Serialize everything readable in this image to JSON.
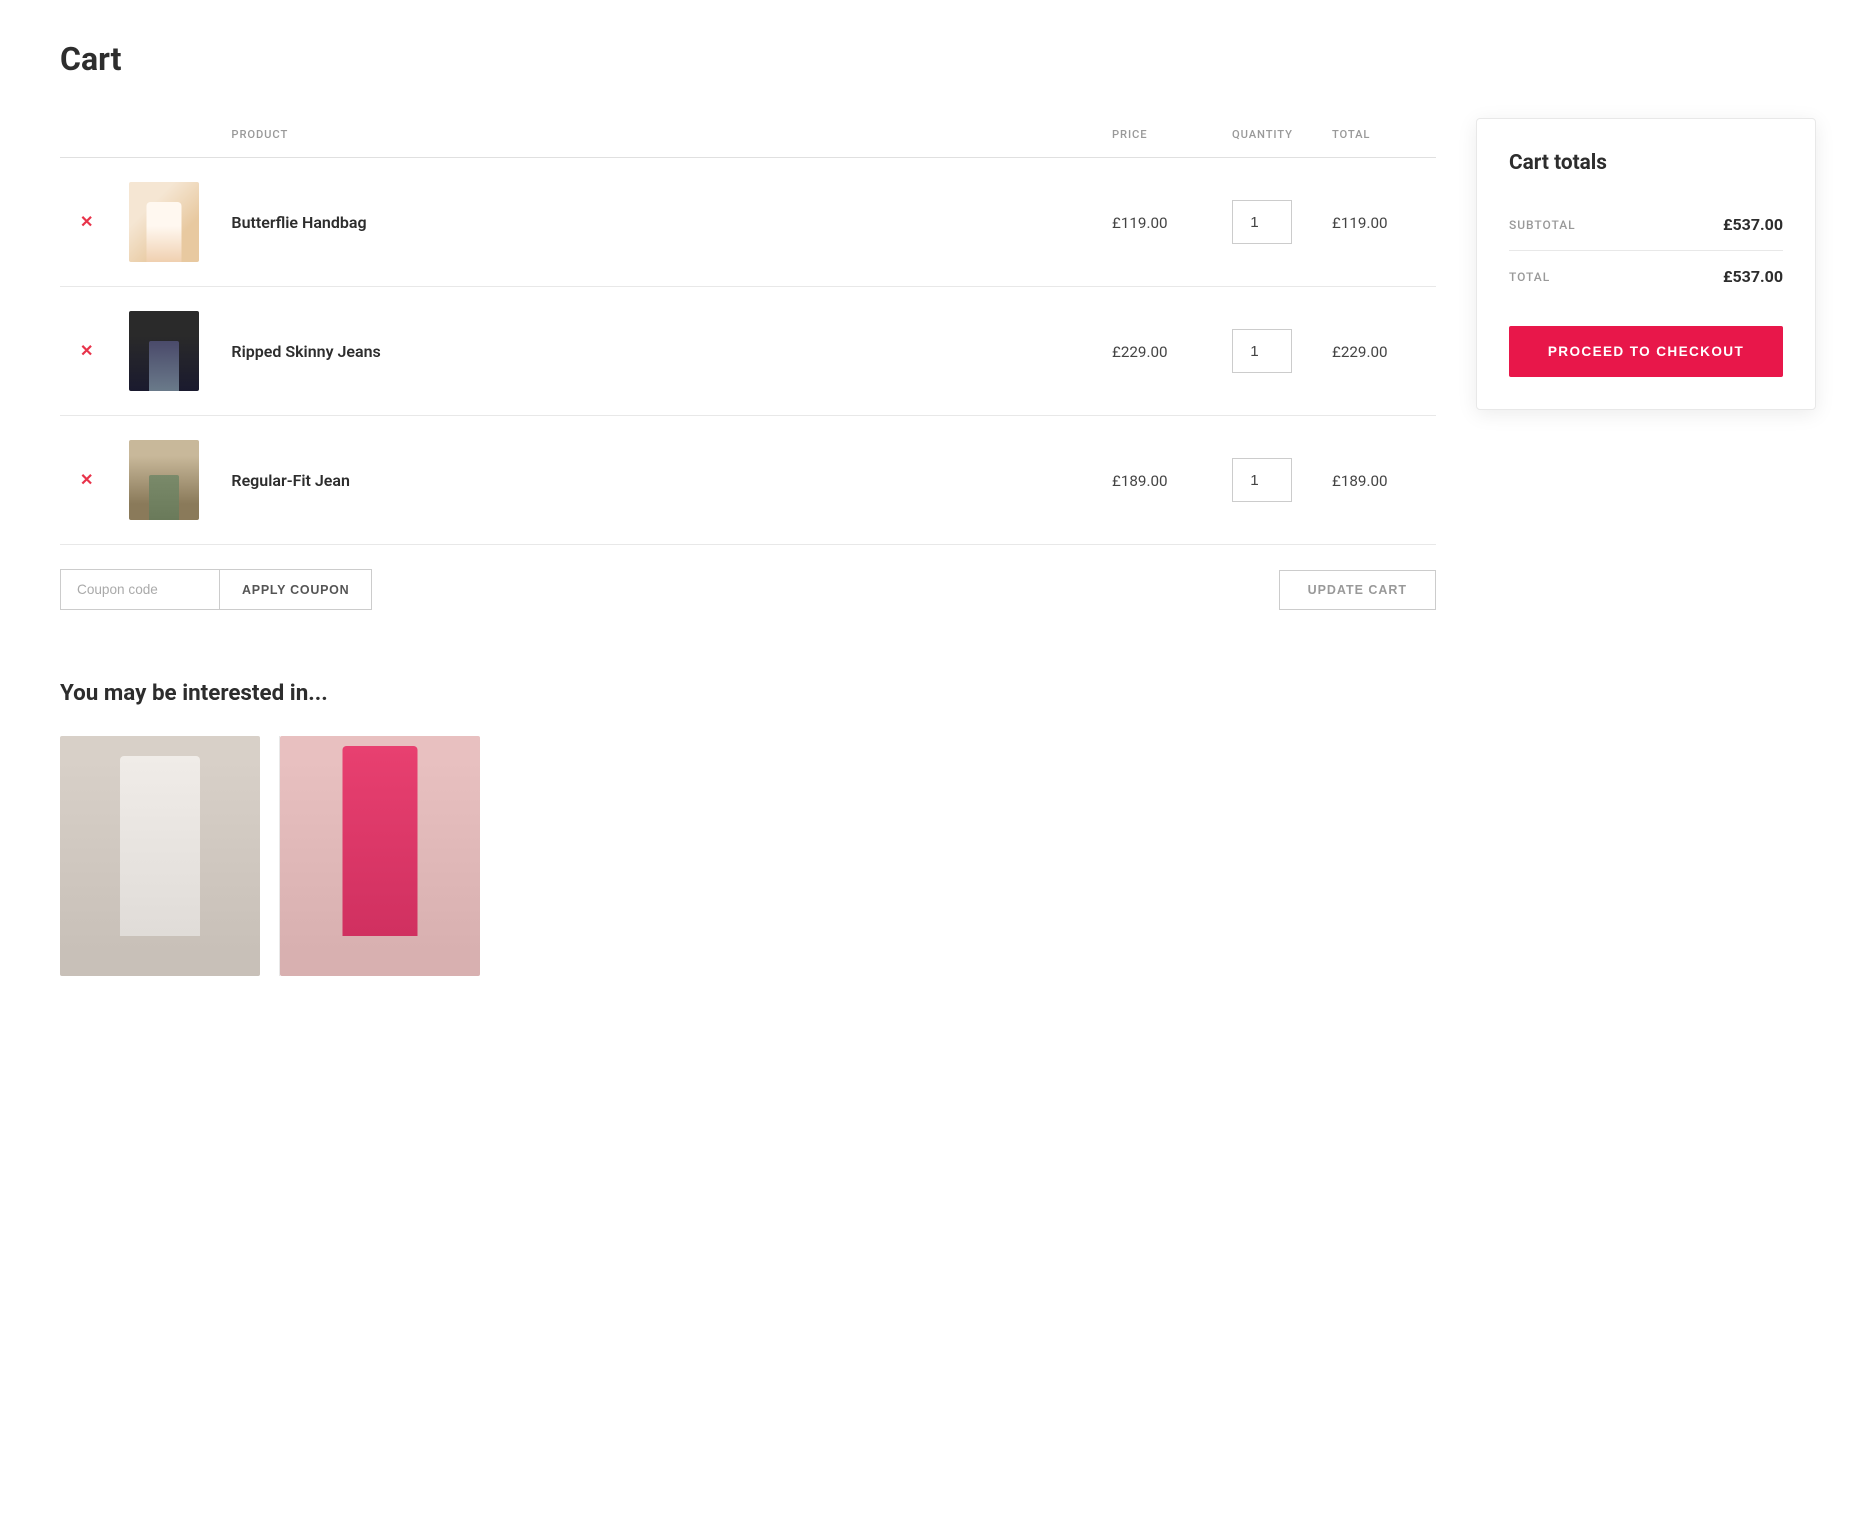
{
  "page": {
    "title": "Cart"
  },
  "table": {
    "headers": {
      "remove": "",
      "image": "",
      "product": "PRODUCT",
      "price": "PRICE",
      "quantity": "QUANTITY",
      "total": "TOTAL"
    },
    "items": [
      {
        "id": "1",
        "name": "Butterflie Handbag",
        "price": "£119.00",
        "quantity": 1,
        "total": "£119.00",
        "image_type": "handbag"
      },
      {
        "id": "2",
        "name": "Ripped Skinny Jeans",
        "price": "£229.00",
        "quantity": 1,
        "total": "£229.00",
        "image_type": "jeans"
      },
      {
        "id": "3",
        "name": "Regular-Fit Jean",
        "price": "£189.00",
        "quantity": 1,
        "total": "£189.00",
        "image_type": "regularjean"
      }
    ]
  },
  "coupon": {
    "placeholder": "Coupon code",
    "apply_label": "APPLY COUPON"
  },
  "update_cart_label": "UPDATE CART",
  "cart_totals": {
    "title": "Cart totals",
    "subtotal_label": "SUBTOTAL",
    "subtotal_value": "£537.00",
    "total_label": "TOTAL",
    "total_value": "£537.00",
    "checkout_label": "PROCEED TO CHECKOUT"
  },
  "recommended": {
    "title": "You may be interested in...",
    "items": [
      {
        "id": "r1",
        "image_type": "blazer"
      },
      {
        "id": "r2",
        "image_type": "pink-blazer"
      }
    ]
  }
}
